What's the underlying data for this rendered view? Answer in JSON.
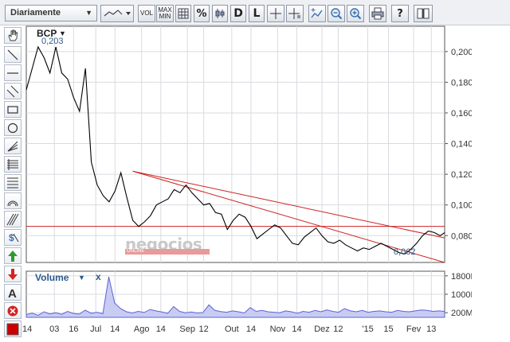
{
  "toolbar": {
    "period_label": "Diariamente",
    "vol_label": "VOL",
    "maxmin_label": "MAX\nMIN",
    "pct_label": "%",
    "d_label": "D",
    "l_label": "L"
  },
  "chart_data": {
    "type": "line",
    "symbol": "BCP",
    "high_label": "0,203",
    "low_label": "0,062",
    "y_ticks": [
      "0,200",
      "0,180",
      "0,160",
      "0,140",
      "0,120",
      "0,100",
      "0,080"
    ],
    "y_tick_values": [
      0.2,
      0.18,
      0.16,
      0.14,
      0.12,
      0.1,
      0.08
    ],
    "ylim": [
      0.0625,
      0.2165
    ],
    "x_labels": [
      "14",
      "03",
      "16",
      "Jul",
      "14",
      "Ago",
      "14",
      "Sep",
      "12",
      "Out",
      "14",
      "Nov",
      "14",
      "Dez",
      "12",
      "'15",
      "15",
      "Fev",
      "13"
    ],
    "x_label_dates": [
      "2014-05-14",
      "2014-06-03",
      "2014-06-16",
      "2014-07-01",
      "2014-07-14",
      "2014-08-01",
      "2014-08-14",
      "2014-09-01",
      "2014-09-12",
      "2014-10-01",
      "2014-10-14",
      "2014-11-01",
      "2014-11-14",
      "2014-12-01",
      "2014-12-12",
      "2015-01-01",
      "2015-01-15",
      "2015-02-01",
      "2015-02-13"
    ],
    "xlim": [
      "2014-05-15",
      "2015-02-22"
    ],
    "price": {
      "x": [
        "2014-05-15",
        "2014-05-19",
        "2014-05-23",
        "2014-05-27",
        "2014-05-31",
        "2014-06-04",
        "2014-06-08",
        "2014-06-12",
        "2014-06-16",
        "2014-06-20",
        "2014-06-24",
        "2014-06-28",
        "2014-07-02",
        "2014-07-06",
        "2014-07-10",
        "2014-07-14",
        "2014-07-18",
        "2014-07-22",
        "2014-07-26",
        "2014-07-30",
        "2014-08-03",
        "2014-08-07",
        "2014-08-11",
        "2014-08-15",
        "2014-08-19",
        "2014-08-23",
        "2014-08-27",
        "2014-08-31",
        "2014-09-04",
        "2014-09-08",
        "2014-09-12",
        "2014-09-16",
        "2014-09-20",
        "2014-09-24",
        "2014-09-28",
        "2014-10-02",
        "2014-10-06",
        "2014-10-10",
        "2014-10-14",
        "2014-10-18",
        "2014-10-22",
        "2014-10-26",
        "2014-10-30",
        "2014-11-03",
        "2014-11-07",
        "2014-11-11",
        "2014-11-15",
        "2014-11-19",
        "2014-11-23",
        "2014-11-27",
        "2014-12-01",
        "2014-12-05",
        "2014-12-09",
        "2014-12-13",
        "2014-12-17",
        "2014-12-21",
        "2014-12-25",
        "2014-12-29",
        "2015-01-02",
        "2015-01-06",
        "2015-01-10",
        "2015-01-14",
        "2015-01-18",
        "2015-01-22",
        "2015-01-26",
        "2015-01-30",
        "2015-02-03",
        "2015-02-07",
        "2015-02-11",
        "2015-02-15",
        "2015-02-19",
        "2015-02-22"
      ],
      "y": [
        0.175,
        0.189,
        0.203,
        0.196,
        0.186,
        0.203,
        0.186,
        0.182,
        0.17,
        0.161,
        0.189,
        0.128,
        0.113,
        0.106,
        0.102,
        0.109,
        0.121,
        0.105,
        0.09,
        0.086,
        0.089,
        0.093,
        0.1,
        0.102,
        0.104,
        0.11,
        0.108,
        0.113,
        0.108,
        0.104,
        0.1,
        0.101,
        0.095,
        0.094,
        0.084,
        0.09,
        0.094,
        0.092,
        0.086,
        0.078,
        0.081,
        0.084,
        0.087,
        0.085,
        0.08,
        0.075,
        0.074,
        0.079,
        0.082,
        0.085,
        0.08,
        0.076,
        0.075,
        0.077,
        0.074,
        0.072,
        0.07,
        0.072,
        0.071,
        0.073,
        0.075,
        0.073,
        0.071,
        0.069,
        0.068,
        0.071,
        0.075,
        0.08,
        0.083,
        0.082,
        0.08,
        0.082
      ]
    },
    "horizontal_line": 0.086,
    "trendlines": [
      {
        "x": [
          "2014-07-26",
          "2015-02-22"
        ],
        "y": [
          0.122,
          0.0625
        ]
      },
      {
        "x": [
          "2014-07-26",
          "2015-02-22"
        ],
        "y": [
          0.122,
          0.0785
        ]
      }
    ],
    "volume": {
      "title": "Volume",
      "close_symbol": "x",
      "y_ticks": [
        "1800M",
        "1000M",
        "200M"
      ],
      "y_tick_values": [
        1800,
        1000,
        200
      ],
      "ylim": [
        0,
        2000
      ],
      "values": [
        120,
        180,
        90,
        240,
        150,
        200,
        130,
        260,
        170,
        140,
        310,
        180,
        220,
        160,
        1760,
        620,
        380,
        240,
        190,
        260,
        210,
        340,
        280,
        230,
        180,
        470,
        260,
        200,
        230,
        190,
        210,
        540,
        300,
        250,
        220,
        280,
        240,
        190,
        420,
        260,
        300,
        240,
        220,
        200,
        280,
        240,
        180,
        260,
        220,
        300,
        240,
        320,
        260,
        220,
        380,
        280,
        240,
        300,
        220,
        260,
        280,
        240,
        220,
        300,
        260,
        240,
        280,
        320,
        300,
        260,
        280,
        260
      ]
    },
    "colors": {
      "price_line": "#000000",
      "trend": "#cc2222",
      "hline": "#cc2222",
      "volume_fill": "#5b63d6",
      "volume_bg": "#c9ccf2",
      "grid": "#d8dbe0"
    }
  },
  "watermark": {
    "text": "negocios",
    "sub": "ONLINE"
  },
  "tools": {
    "color_swatch": "#cc0000"
  }
}
